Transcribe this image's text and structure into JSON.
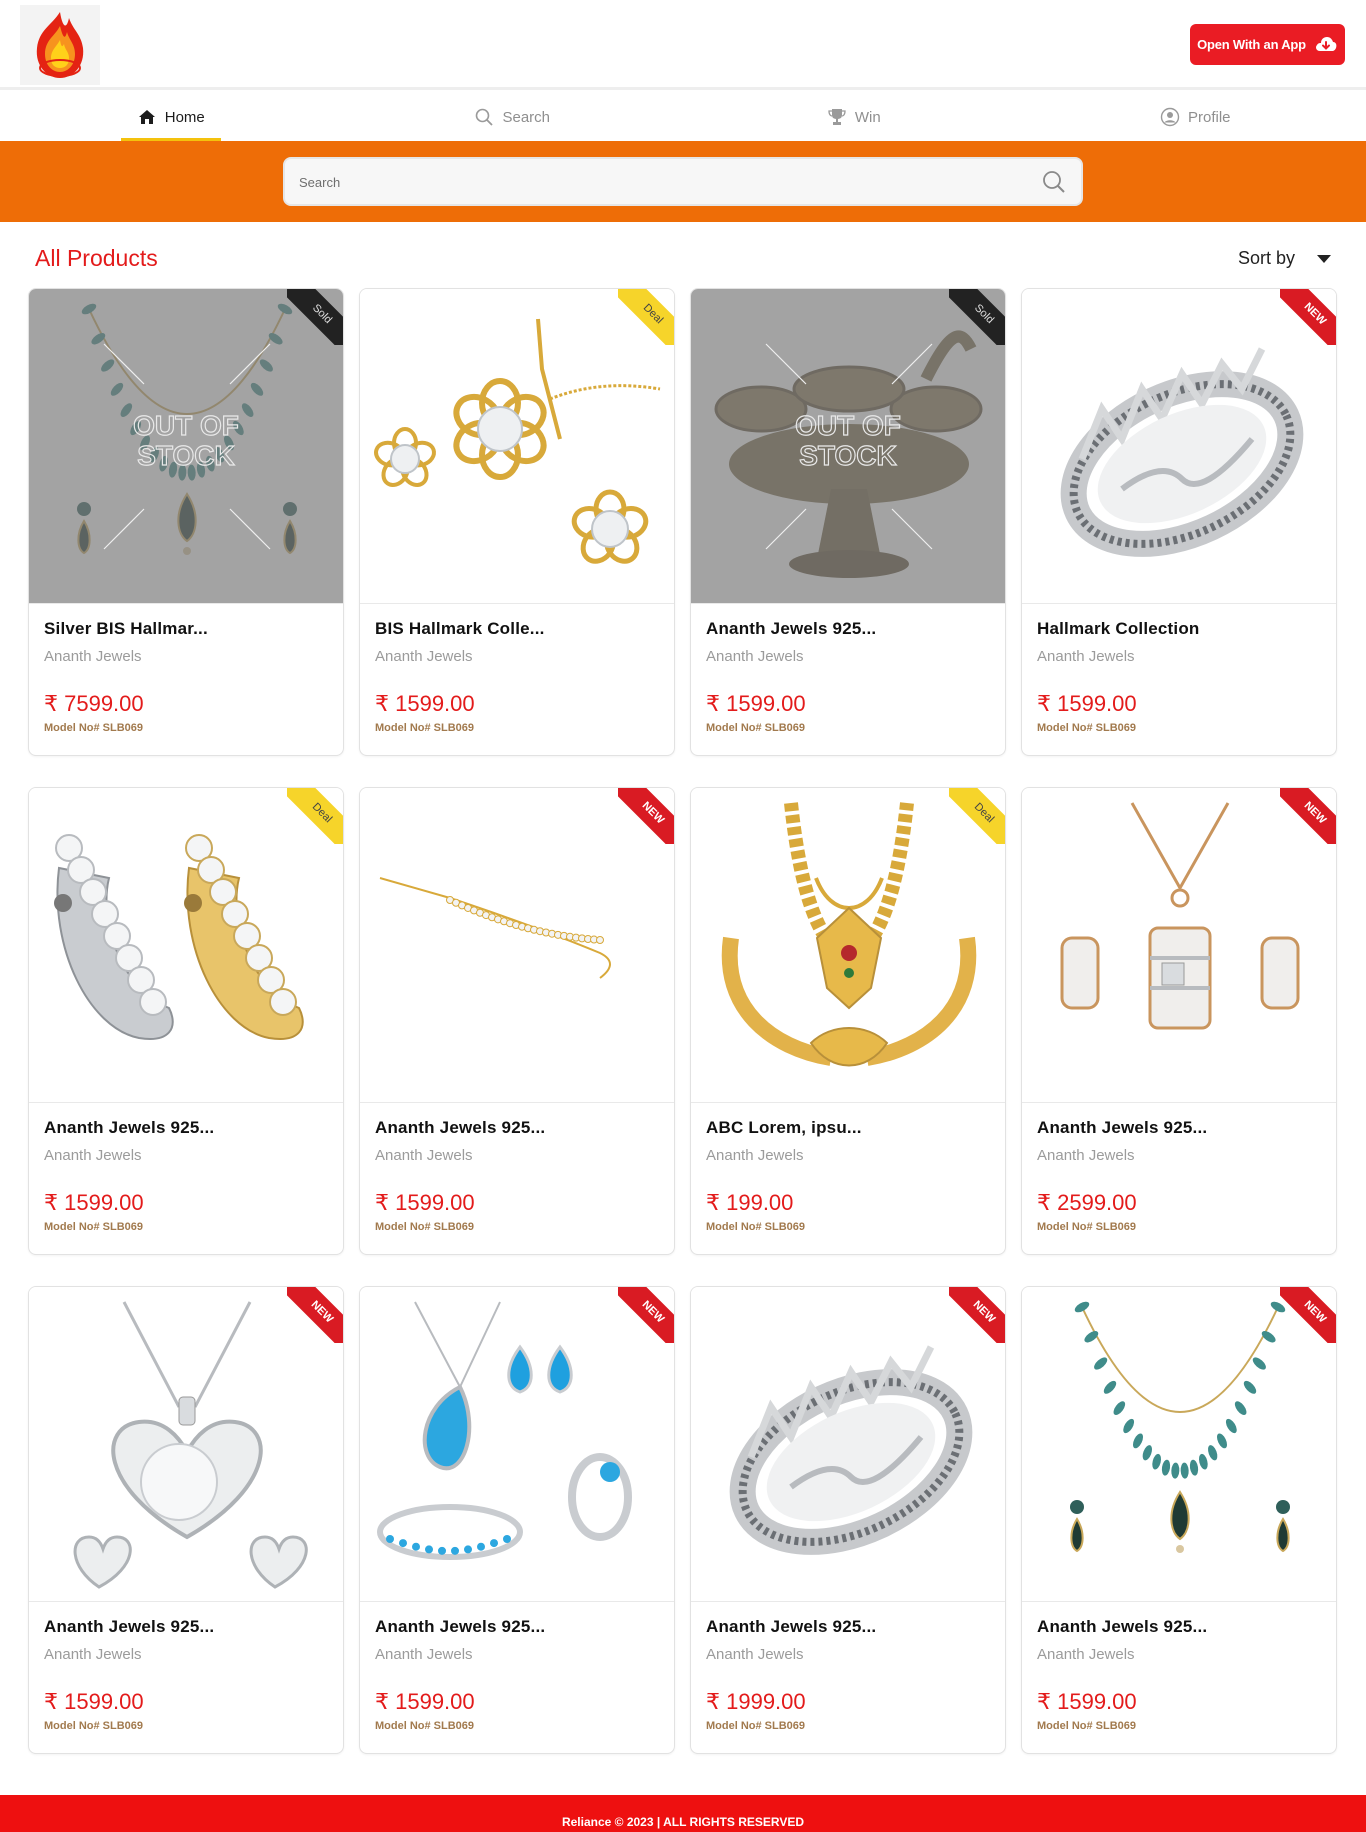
{
  "header": {
    "app_button_label": "Open With an App"
  },
  "nav": {
    "items": [
      {
        "label": "Home",
        "icon": "home-icon",
        "active": true
      },
      {
        "label": "Search",
        "icon": "search-icon",
        "active": false
      },
      {
        "label": "Win",
        "icon": "trophy-icon",
        "active": false
      },
      {
        "label": "Profile",
        "icon": "user-icon",
        "active": false
      }
    ]
  },
  "search": {
    "placeholder": "Search"
  },
  "section": {
    "title": "All Products",
    "sort_label": "Sort by"
  },
  "badges": {
    "sold": "Sold",
    "deal": "Deal",
    "new": "NEW",
    "out_of_stock": "OUT OF\nSTOCK"
  },
  "products": [
    {
      "name": "Silver BIS Hallmar...",
      "seller": "Ananth Jewels",
      "price": "₹ 7599.00",
      "model": "Model No# SLB069",
      "badge": "sold",
      "out_of_stock": true,
      "art": "necklace-set"
    },
    {
      "name": "BIS Hallmark Colle...",
      "seller": "Ananth Jewels",
      "price": "₹ 1599.00",
      "model": "Model No# SLB069",
      "badge": "deal",
      "out_of_stock": false,
      "art": "gold-flower-set"
    },
    {
      "name": "Ananth Jewels 925...",
      "seller": "Ananth Jewels",
      "price": "₹ 1599.00",
      "model": "Model No# SLB069",
      "badge": "sold",
      "out_of_stock": true,
      "art": "brass-lamp"
    },
    {
      "name": "Hallmark Collection",
      "seller": "Ananth Jewels",
      "price": "₹ 1599.00",
      "model": "Model No# SLB069",
      "badge": "new",
      "out_of_stock": false,
      "art": "crown-ring"
    },
    {
      "name": "Ananth Jewels 925...",
      "seller": "Ananth Jewels",
      "price": "₹ 1599.00",
      "model": "Model No# SLB069",
      "badge": "deal",
      "out_of_stock": false,
      "art": "hoop-earrings"
    },
    {
      "name": "Ananth Jewels 925...",
      "seller": "Ananth Jewels",
      "price": "₹ 1599.00",
      "model": "Model No# SLB069",
      "badge": "new",
      "out_of_stock": false,
      "art": "gold-chain"
    },
    {
      "name": "ABC Lorem, ipsu...",
      "seller": "Ananth Jewels",
      "price": "₹ 199.00",
      "model": "Model No# SLB069",
      "badge": "deal",
      "out_of_stock": false,
      "art": "gold-mangalsutra"
    },
    {
      "name": "Ananth Jewels 925...",
      "seller": "Ananth Jewels",
      "price": "₹ 2599.00",
      "model": "Model No# SLB069",
      "badge": "new",
      "out_of_stock": false,
      "art": "rose-pendant-set"
    },
    {
      "name": "Ananth Jewels 925...",
      "seller": "Ananth Jewels",
      "price": "₹ 1599.00",
      "model": "Model No# SLB069",
      "badge": "new",
      "out_of_stock": false,
      "art": "heart-pendant-set"
    },
    {
      "name": "Ananth Jewels 925...",
      "seller": "Ananth Jewels",
      "price": "₹ 1599.00",
      "model": "Model No# SLB069",
      "badge": "new",
      "out_of_stock": false,
      "art": "blue-crystal-set"
    },
    {
      "name": "Ananth Jewels 925...",
      "seller": "Ananth Jewels",
      "price": "₹ 1999.00",
      "model": "Model No# SLB069",
      "badge": "new",
      "out_of_stock": false,
      "art": "crown-ring"
    },
    {
      "name": "Ananth Jewels 925...",
      "seller": "Ananth Jewels",
      "price": "₹ 1599.00",
      "model": "Model No# SLB069",
      "badge": "new",
      "out_of_stock": false,
      "art": "necklace-set"
    }
  ],
  "footer": {
    "text": "Reliance © 2023 | ALL RIGHTS RESERVED"
  },
  "colors": {
    "primary_red": "#ea1c24",
    "band_orange": "#ee6d07",
    "price_red": "#e31b1b",
    "active_underline": "#f4c20d"
  }
}
